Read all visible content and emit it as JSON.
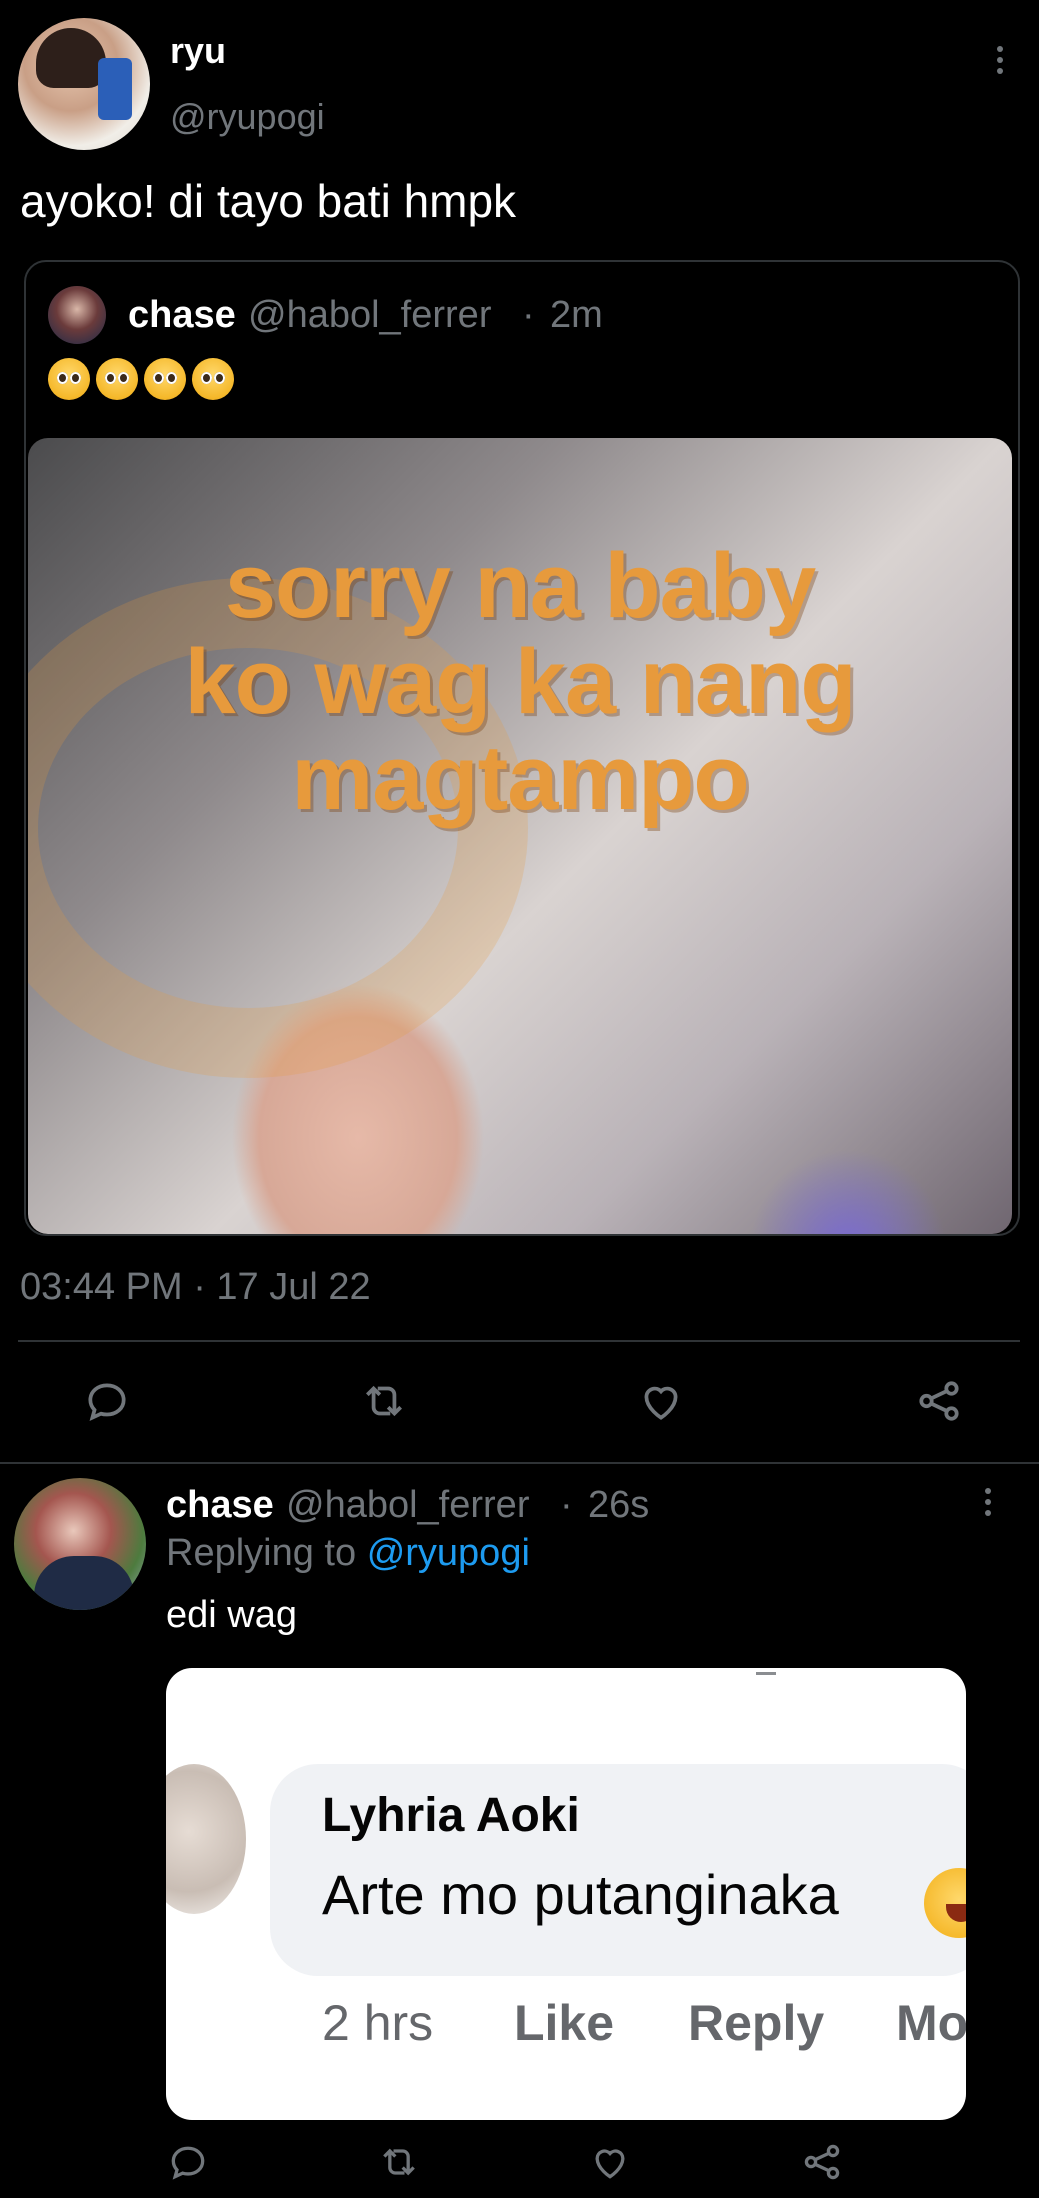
{
  "tweet": {
    "display_name": "ryu",
    "handle": "@ryupogi",
    "text": "ayoko! di tayo bati hmpk",
    "timestamp": "03:44 PM · 17 Jul 22"
  },
  "quoted": {
    "display_name": "chase",
    "handle": "@habol_ferrer",
    "separator": "·",
    "time": "2m",
    "emojis": [
      "🥺",
      "🥺",
      "🥺",
      "🥺"
    ],
    "image_text": [
      "sorry na baby",
      "ko wag ka nang",
      "magtampo"
    ]
  },
  "actions": {
    "reply_icon": "reply-icon",
    "retweet_icon": "retweet-icon",
    "like_icon": "heart-icon",
    "share_icon": "share-icon"
  },
  "reply": {
    "display_name": "chase",
    "handle": "@habol_ferrer",
    "separator": "·",
    "time": "26s",
    "replying_prefix": "Replying to",
    "replying_to": "@ryupogi",
    "text": "edi wag",
    "embedded_comment": {
      "author": "Lyhria Aoki",
      "text": "Arte mo putanginaka",
      "age": "2 hrs",
      "like": "Like",
      "reply": "Reply",
      "more": "Mo"
    }
  },
  "colors": {
    "background": "#000000",
    "text": "#e7e9ea",
    "muted": "#71767b",
    "accent": "#1d9bf0",
    "meme_text": "#e79a3c"
  }
}
